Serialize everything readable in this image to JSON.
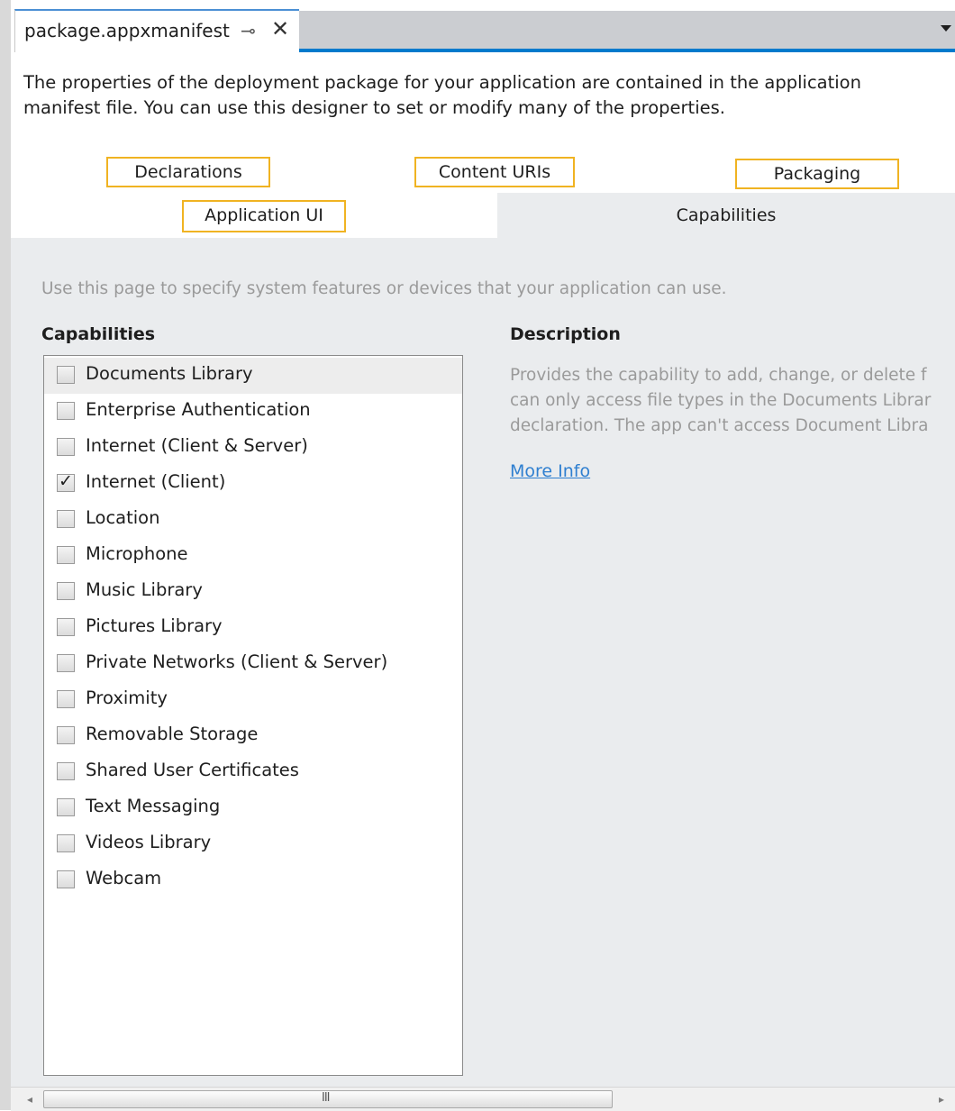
{
  "document_tab": {
    "title": "package.appxmanifest",
    "pin_icon": "pin-icon",
    "close_icon": "close-icon",
    "accent_color": "#007acc"
  },
  "intro": "The properties of the deployment package for your application are contained in the application manifest file. You can use this designer to set or modify many of the properties.",
  "designer_tabs": {
    "declarations": "Declarations",
    "content_uris": "Content URIs",
    "packaging": "Packaging",
    "application_ui": "Application UI",
    "capabilities": "Capabilities",
    "highlight_color": "#f0b322"
  },
  "hint": "Use this page to specify system features or devices that your application can use.",
  "capabilities_heading": "Capabilities",
  "description_heading": "Description",
  "capabilities": [
    {
      "label": "Documents Library",
      "checked": false
    },
    {
      "label": "Enterprise Authentication",
      "checked": false
    },
    {
      "label": "Internet (Client & Server)",
      "checked": false
    },
    {
      "label": "Internet (Client)",
      "checked": true
    },
    {
      "label": "Location",
      "checked": false
    },
    {
      "label": "Microphone",
      "checked": false
    },
    {
      "label": "Music Library",
      "checked": false
    },
    {
      "label": "Pictures Library",
      "checked": false
    },
    {
      "label": "Private Networks (Client & Server)",
      "checked": false
    },
    {
      "label": "Proximity",
      "checked": false
    },
    {
      "label": "Removable Storage",
      "checked": false
    },
    {
      "label": "Shared User Certificates",
      "checked": false
    },
    {
      "label": "Text Messaging",
      "checked": false
    },
    {
      "label": "Videos Library",
      "checked": false
    },
    {
      "label": "Webcam",
      "checked": false
    }
  ],
  "description": {
    "lines": [
      "Provides the capability to add, change, or delete f",
      "can only access file types in the Documents Librar",
      "declaration. The app can't access Document Libra"
    ],
    "more_info": "More Info"
  },
  "scrollbar": {
    "left_arrow": "◂",
    "right_arrow": "▸",
    "grip": "III"
  }
}
